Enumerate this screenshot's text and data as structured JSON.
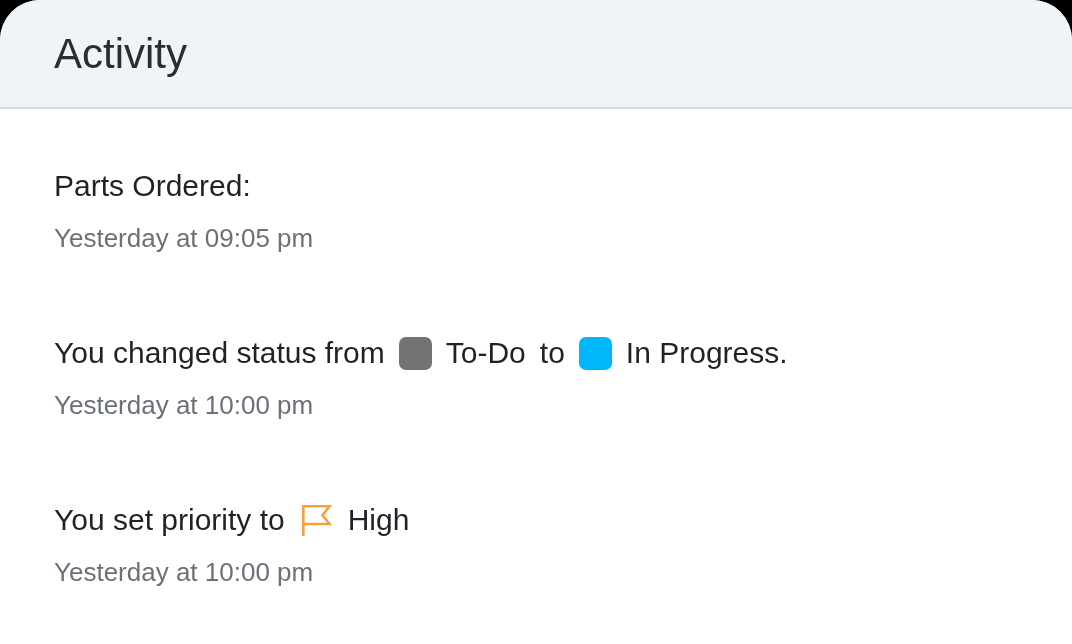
{
  "panel": {
    "title": "Activity"
  },
  "activities": [
    {
      "parts": [
        {
          "kind": "text",
          "text": "Parts Ordered:"
        }
      ],
      "time": "Yesterday at 09:05 pm"
    },
    {
      "parts": [
        {
          "kind": "text",
          "text": "You changed status from"
        },
        {
          "kind": "status",
          "label": "To-Do",
          "color": "#737373"
        },
        {
          "kind": "text",
          "text": "to"
        },
        {
          "kind": "status",
          "label": "In Progress.",
          "color": "#00b7fb"
        }
      ],
      "time": "Yesterday at 10:00 pm"
    },
    {
      "parts": [
        {
          "kind": "text",
          "text": "You set priority to"
        },
        {
          "kind": "priority",
          "label": "High",
          "color": "#f5a23c"
        }
      ],
      "time": "Yesterday at 10:00 pm"
    }
  ]
}
